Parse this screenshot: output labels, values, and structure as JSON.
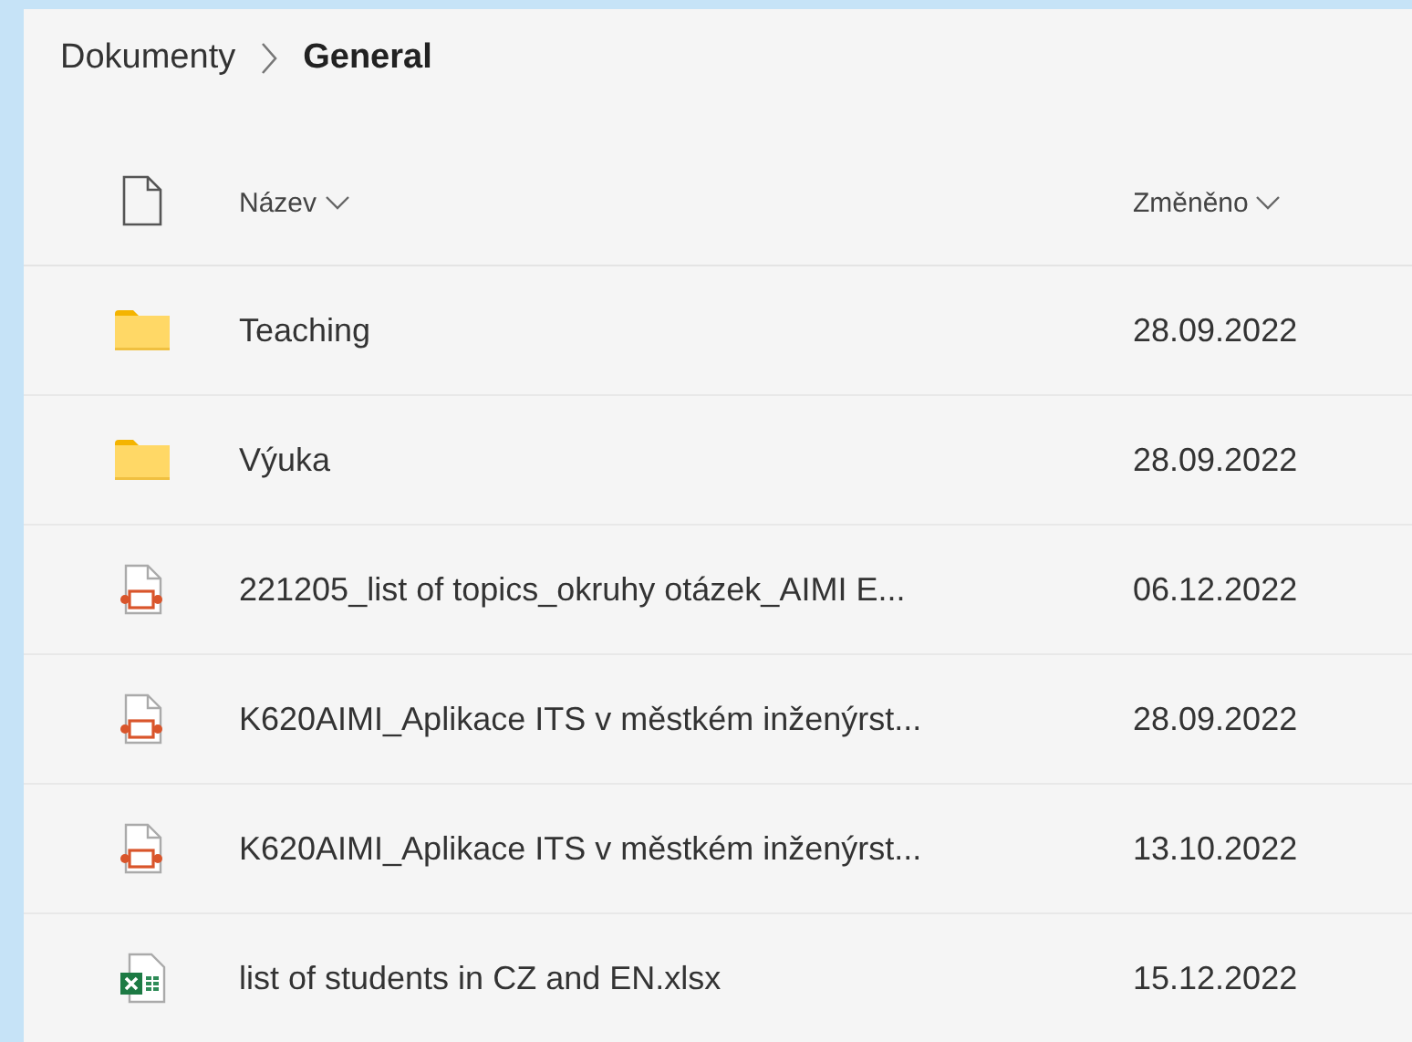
{
  "breadcrumb": {
    "parent": "Dokumenty",
    "current": "General"
  },
  "table": {
    "columns": [
      {
        "label": "Název"
      },
      {
        "label": "Změněno"
      }
    ],
    "rows": [
      {
        "kind": "folder",
        "name": "Teaching",
        "modified": "28.09.2022"
      },
      {
        "kind": "folder",
        "name": "Výuka",
        "modified": "28.09.2022"
      },
      {
        "kind": "presentation",
        "name": "221205_list of topics_okruhy otázek_AIMI E...",
        "modified": "06.12.2022"
      },
      {
        "kind": "presentation",
        "name": "K620AIMI_Aplikace ITS v městkém inženýrst...",
        "modified": "28.09.2022"
      },
      {
        "kind": "presentation",
        "name": "K620AIMI_Aplikace ITS v městkém inženýrst...",
        "modified": "13.10.2022"
      },
      {
        "kind": "spreadsheet",
        "name": "list of students in CZ and EN.xlsx",
        "modified": "15.12.2022"
      }
    ]
  }
}
